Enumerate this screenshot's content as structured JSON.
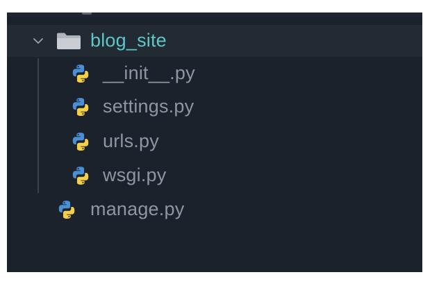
{
  "explorer": {
    "folder": {
      "name": "blog_site",
      "expanded": true,
      "icon": "folder-icon",
      "label_color": "#5fc7c6"
    },
    "children": [
      {
        "name": "__init__.py",
        "icon": "python-icon"
      },
      {
        "name": "settings.py",
        "icon": "python-icon"
      },
      {
        "name": "urls.py",
        "icon": "python-icon"
      },
      {
        "name": "wsgi.py",
        "icon": "python-icon"
      }
    ],
    "root_files": [
      {
        "name": "manage.py",
        "icon": "python-icon"
      }
    ],
    "colors": {
      "background": "#1b222b",
      "selected_row": "#222a33",
      "file_text": "#8d96a2",
      "python_blue": "#4a8ed6",
      "python_yellow": "#f4cf48"
    }
  }
}
